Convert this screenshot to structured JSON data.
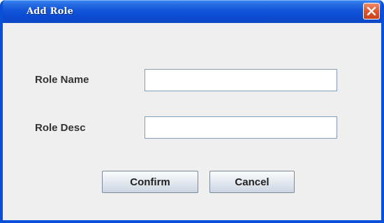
{
  "window": {
    "title": "Add Role",
    "close_icon": "close-icon"
  },
  "form": {
    "role_name_label": "Role Name",
    "role_name_value": "",
    "role_desc_label": "Role Desc",
    "role_desc_value": ""
  },
  "buttons": {
    "confirm_label": "Confirm",
    "cancel_label": "Cancel"
  },
  "colors": {
    "titlebar": "#0b4bd2",
    "close": "#e0552e",
    "dialog_bg": "#efefef"
  }
}
